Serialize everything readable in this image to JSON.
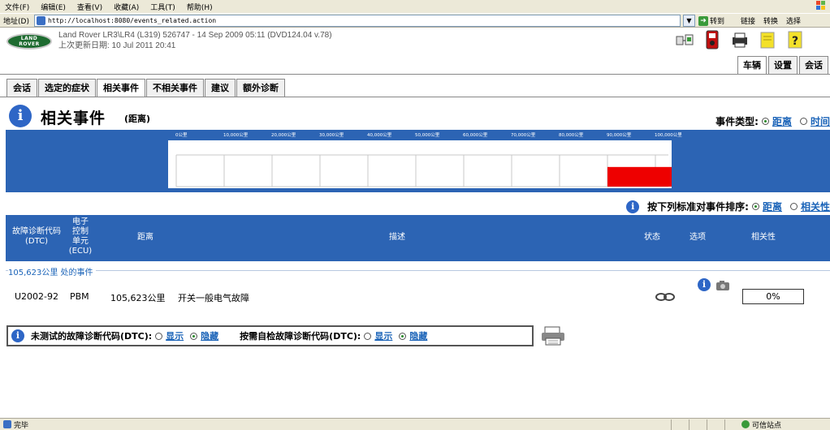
{
  "browser": {
    "menu": [
      "文件(F)",
      "编辑(E)",
      "查看(V)",
      "收藏(A)",
      "工具(T)",
      "帮助(H)"
    ],
    "address_label": "地址(D)",
    "url": "http://localhost:8080/events_related.action",
    "go_label": "转到",
    "tools": [
      "链接",
      "转换",
      "选择"
    ]
  },
  "header": {
    "logo_line1": "LAND",
    "logo_line2": "ROVER",
    "vehicle_line": "Land Rover LR3\\LR4 (L319) 526747 - 14 Sep 2009 05:11 (DVD124.04 v.78)",
    "updated_line": "上次更新日期: 10 Jul 2011 20:41",
    "right_tabs": [
      "车辆",
      "设置",
      "会话"
    ]
  },
  "tabs": [
    "会话",
    "选定的症状",
    "相关事件",
    "不相关事件",
    "建议",
    "额外诊断"
  ],
  "active_tab": 2,
  "page": {
    "title": "相关事件",
    "subtitle": "(距离)",
    "event_type_label": "事件类型:",
    "event_type_distance": "距离",
    "event_type_time": "时间",
    "sort_label": "按下列标准对事件排序:",
    "sort_distance": "距离",
    "sort_relevance": "相关性"
  },
  "chart_data": {
    "type": "bar",
    "x_ticks": [
      "0公里",
      "10,000公里",
      "20,000公里",
      "30,000公里",
      "40,000公里",
      "50,000公里",
      "60,000公里",
      "70,000公里",
      "80,000公里",
      "90,000公里",
      "100,000公里"
    ],
    "xlim": [
      0,
      105623
    ],
    "events": [
      {
        "distance_km": 105623,
        "start_km": 90000,
        "relative_height": 0.62,
        "color": "#ee0000"
      }
    ]
  },
  "table": {
    "headers": {
      "dtc": [
        "故障诊断代码",
        "(DTC)"
      ],
      "ecu": [
        "电子",
        "控制",
        "单元",
        "(ECU)"
      ],
      "distance": "距离",
      "description": "描述",
      "status": "状态",
      "options": "选项",
      "relevance": "相关性"
    },
    "group_label": "105,623公里 处的事件",
    "rows": [
      {
        "dtc": "U2002-92",
        "ecu": "PBM",
        "distance": "105,623公里",
        "description": "开关一般电气故障",
        "relevance": "0%"
      }
    ]
  },
  "options": {
    "untested_label": "未测试的故障诊断代码(DTC):",
    "show": "显示",
    "hide": "隐藏",
    "selftest_label": "按需自检故障诊断代码(DTC):"
  },
  "status": {
    "left": "完毕",
    "right": "可信站点"
  }
}
